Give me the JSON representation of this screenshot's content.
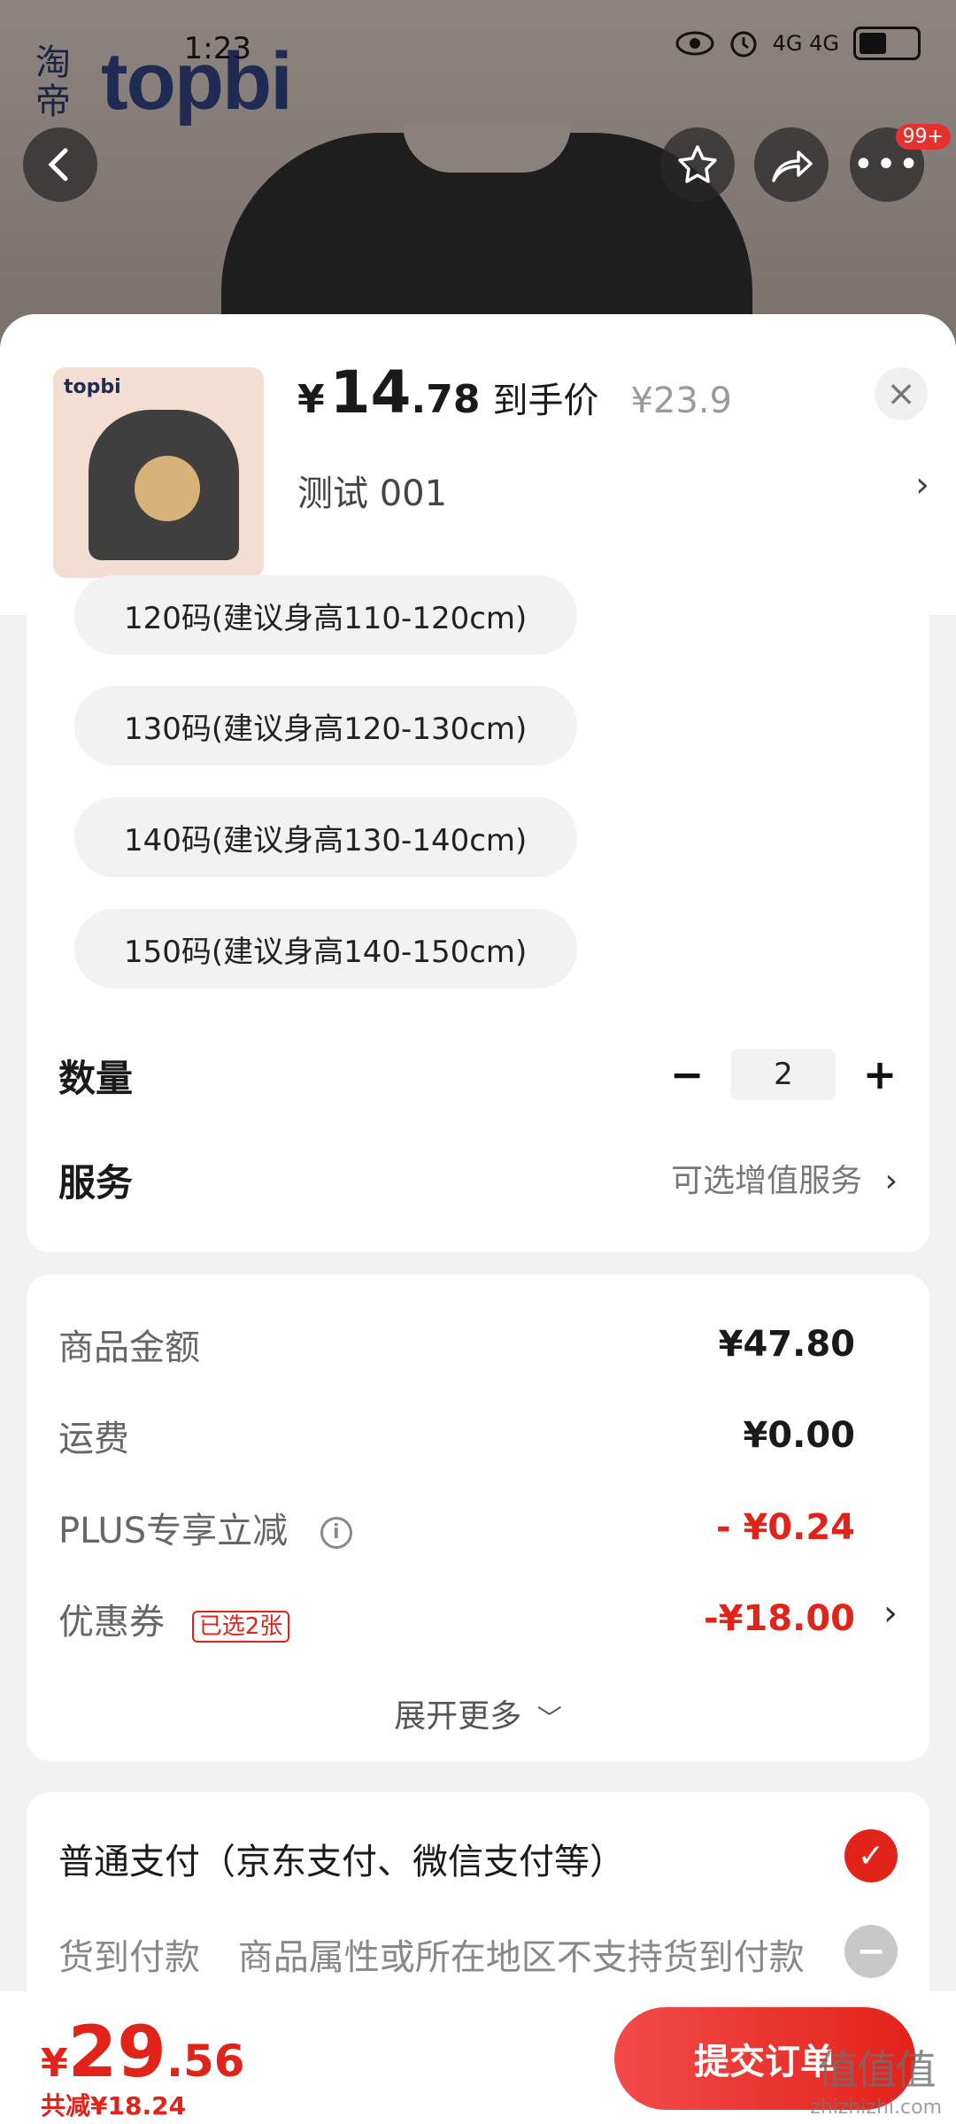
{
  "status_bar": {
    "time": "1:23",
    "network": "4G 4G"
  },
  "backdrop": {
    "brand_seal": "淘帝",
    "brand_logo": "topbi",
    "menu_badge": "99+"
  },
  "product": {
    "price_symbol": "¥",
    "price_int": "14",
    "price_dec": ".78",
    "price_tag": "到手价",
    "original_price": "¥23.9",
    "selected_spec": "测试  001",
    "thumb_brand": "topbi"
  },
  "sizes": [
    "120码(建议身高110-120cm)",
    "130码(建议身高120-130cm)",
    "140码(建议身高130-140cm)",
    "150码(建议身高140-150cm)"
  ],
  "quantity": {
    "label": "数量",
    "value": "2",
    "minus": "−",
    "plus": "+"
  },
  "service": {
    "label": "服务",
    "value": "可选增值服务"
  },
  "costs": {
    "goods_label": "商品金额",
    "goods_value": "¥47.80",
    "shipping_label": "运费",
    "shipping_value": "¥0.00",
    "plus_label": "PLUS专享立减",
    "plus_value": "- ¥0.24",
    "coupon_label": "优惠券",
    "coupon_tag": "已选2张",
    "coupon_value": "-¥18.00",
    "expand_label": "展开更多"
  },
  "payment": {
    "normal_label": "普通支付（京东支付、微信支付等）",
    "cod_label": "货到付款",
    "cod_note": "商品属性或所在地区不支持货到付款"
  },
  "bottom": {
    "total_symbol": "¥",
    "total_int": "29",
    "total_dec": ".56",
    "saved": "共减¥18.24",
    "submit_label": "提交订单",
    "watermark_big": "值值值",
    "watermark_small": "zhizhizhi.com"
  },
  "icons": {
    "back": "back-arrow-icon",
    "favorite": "star-icon",
    "share": "share-icon",
    "more": "more-icon",
    "close": "close-icon",
    "info": "info-icon",
    "chevron": "chevron-right-icon"
  },
  "colors": {
    "accent": "#e2231a",
    "panel_bg": "#ffffff",
    "sheet_bg": "#f2f2f2"
  }
}
